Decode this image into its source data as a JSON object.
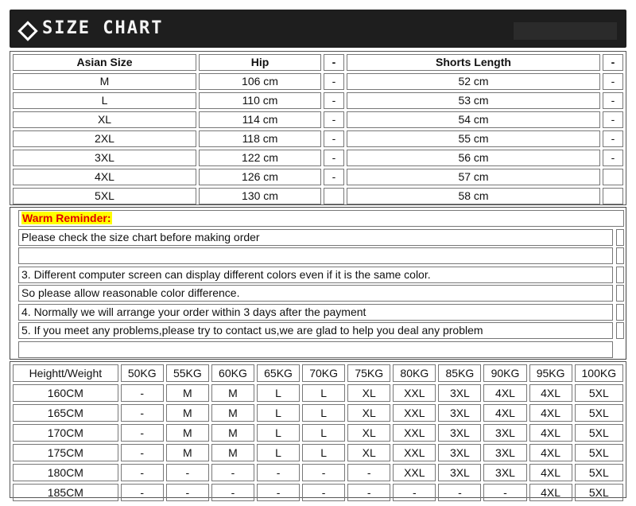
{
  "banner": {
    "title": "SIZE CHART",
    "icon": "diamond-outline-icon"
  },
  "size_table": {
    "headers": [
      "Asian Size",
      "Hip",
      "-",
      "Shorts Length",
      "-"
    ],
    "rows": [
      [
        "M",
        "106 cm",
        "-",
        "52 cm",
        "-"
      ],
      [
        "L",
        "110 cm",
        "-",
        "53 cm",
        "-"
      ],
      [
        "XL",
        "114 cm",
        "-",
        "54 cm",
        "-"
      ],
      [
        "2XL",
        "118 cm",
        "-",
        "55 cm",
        "-"
      ],
      [
        "3XL",
        "122 cm",
        "-",
        "56 cm",
        "-"
      ],
      [
        "4XL",
        "126 cm",
        "-",
        "57 cm",
        ""
      ],
      [
        "5XL",
        "130 cm",
        "",
        "58 cm",
        ""
      ]
    ]
  },
  "reminder": {
    "title": "Warm Reminder:",
    "lines": [
      "Please check the size chart before making order",
      "",
      "3. Different computer screen can display different colors even if it is the same color.",
      "So please allow reasonable color difference.",
      "4. Normally we will arrange your order within 3 days after the payment",
      "5. If you meet any problems,please try to contact us,we are glad to help you deal any problem",
      ""
    ]
  },
  "weight_table": {
    "headers": [
      "Heightt/Weight",
      "50KG",
      "55KG",
      "60KG",
      "65KG",
      "70KG",
      "75KG",
      "80KG",
      "85KG",
      "90KG",
      "95KG",
      "100KG"
    ],
    "rows": [
      [
        "160CM",
        "-",
        "M",
        "M",
        "L",
        "L",
        "XL",
        "XXL",
        "3XL",
        "4XL",
        "4XL",
        "5XL"
      ],
      [
        "165CM",
        "-",
        "M",
        "M",
        "L",
        "L",
        "XL",
        "XXL",
        "3XL",
        "4XL",
        "4XL",
        "5XL"
      ],
      [
        "170CM",
        "-",
        "M",
        "M",
        "L",
        "L",
        "XL",
        "XXL",
        "3XL",
        "3XL",
        "4XL",
        "5XL"
      ],
      [
        "175CM",
        "-",
        "M",
        "M",
        "L",
        "L",
        "XL",
        "XXL",
        "3XL",
        "3XL",
        "4XL",
        "5XL"
      ],
      [
        "180CM",
        "-",
        "-",
        "-",
        "-",
        "-",
        "-",
        "XXL",
        "3XL",
        "3XL",
        "4XL",
        "5XL"
      ],
      [
        "185CM",
        "-",
        "-",
        "-",
        "-",
        "-",
        "-",
        "-",
        "-",
        "-",
        "4XL",
        "5XL"
      ]
    ]
  }
}
